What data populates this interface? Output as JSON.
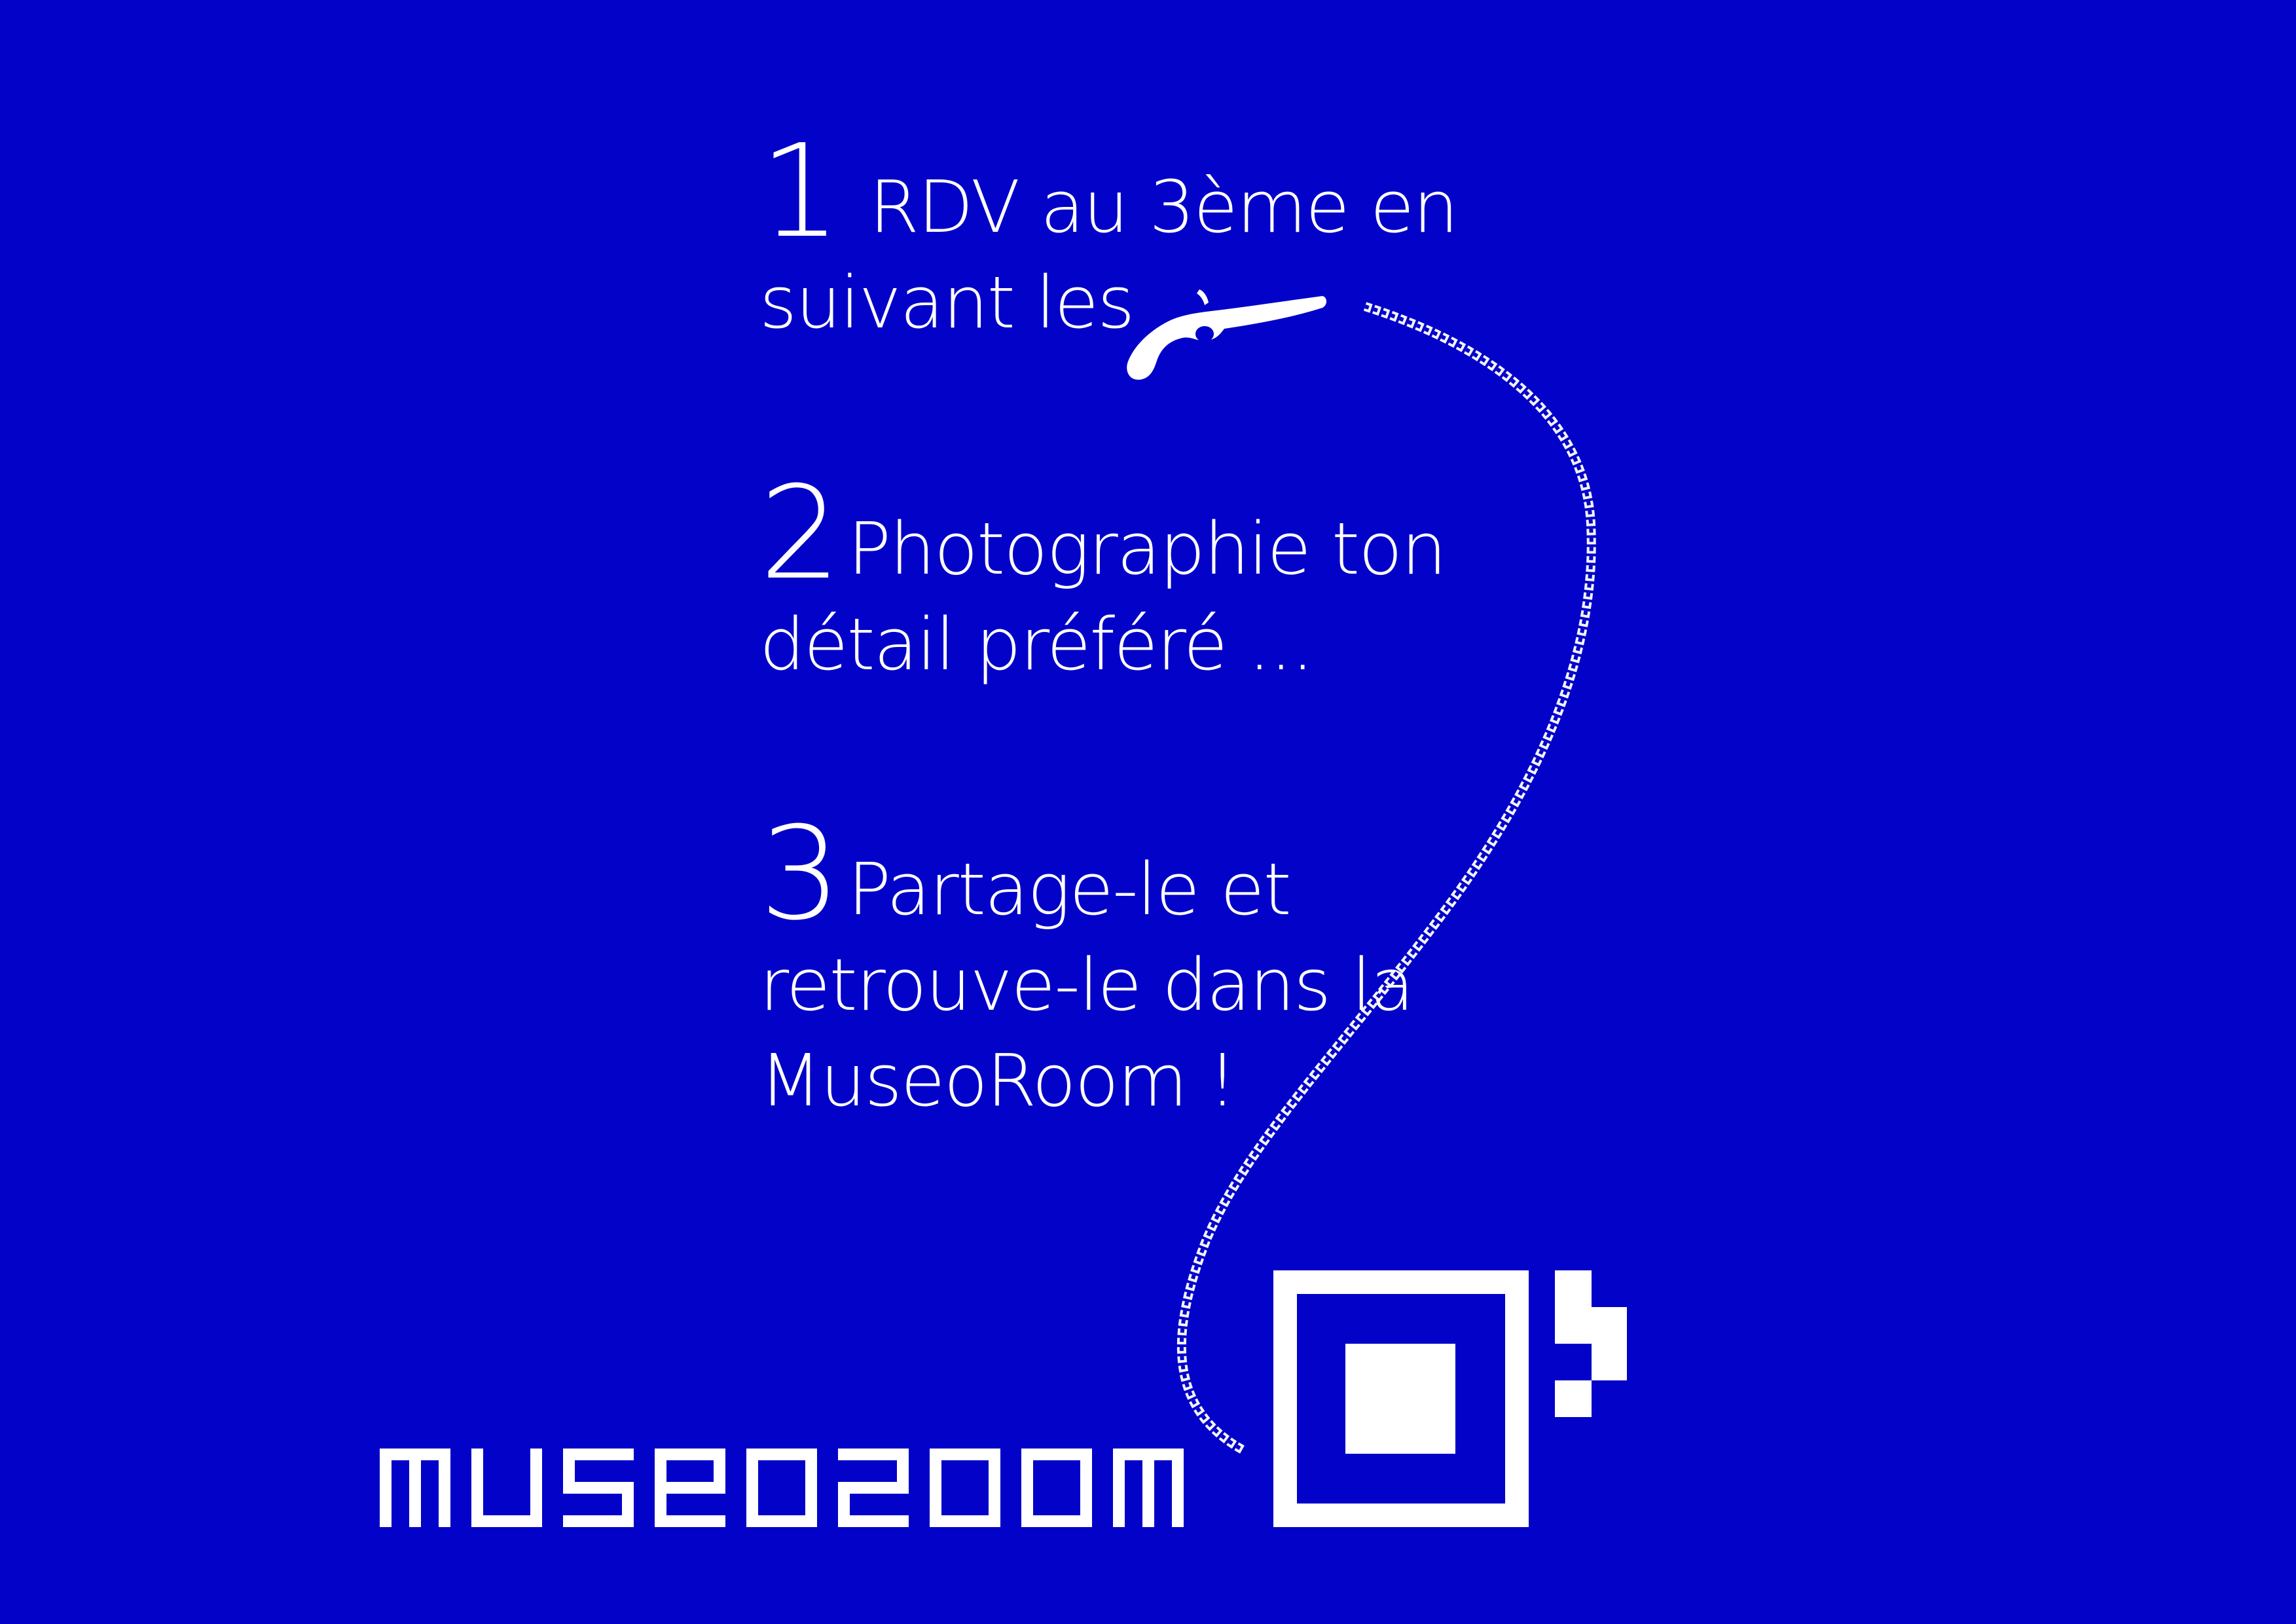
{
  "colors": {
    "background": "#0202C8",
    "foreground": "#FFFFFF"
  },
  "steps": [
    {
      "number": "1",
      "lines": [
        "RDV au 3ème en",
        "suivant les"
      ]
    },
    {
      "number": "2",
      "lines": [
        "Photographie ton",
        "détail préféré ..."
      ]
    },
    {
      "number": "3",
      "lines": [
        "Partage-le et",
        "retrouve-le dans la",
        "MuseoRoom !"
      ]
    }
  ],
  "brand": {
    "wordmark": "MUSEOZOOM"
  },
  "icons": {
    "pistol": "pistol-icon",
    "trail": "pixel-trail",
    "logo": "museozoom-logo-mark"
  }
}
